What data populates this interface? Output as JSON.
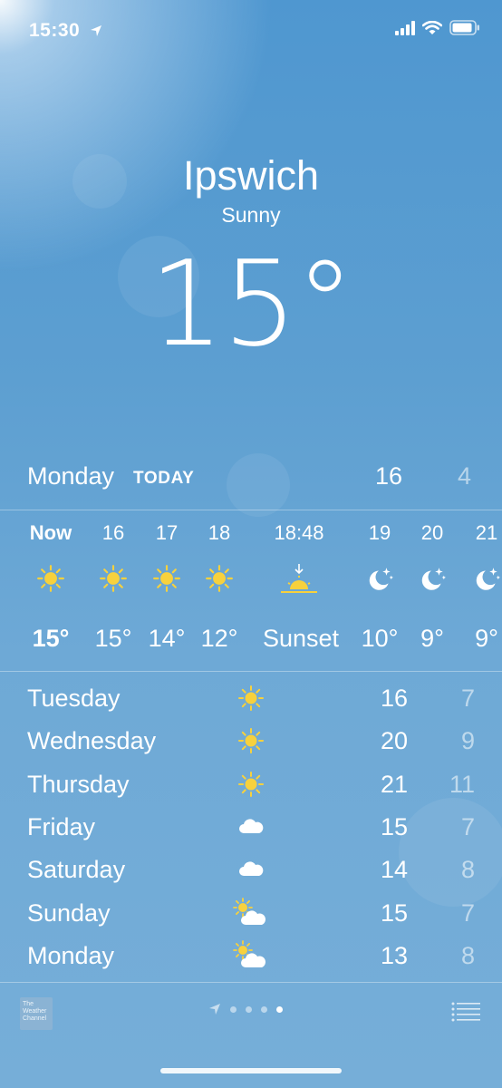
{
  "status_bar": {
    "time": "15:30"
  },
  "hero": {
    "city": "Ipswich",
    "condition": "Sunny",
    "temperature": "15°"
  },
  "today": {
    "day": "Monday",
    "tag": "TODAY",
    "high": "16",
    "low": "4"
  },
  "hourly": [
    {
      "time": "Now",
      "icon": "sun-icon",
      "temp": "15°",
      "bold": true
    },
    {
      "time": "16",
      "icon": "sun-icon",
      "temp": "15°"
    },
    {
      "time": "17",
      "icon": "sun-icon",
      "temp": "14°"
    },
    {
      "time": "18",
      "icon": "sun-icon",
      "temp": "12°"
    },
    {
      "time": "18:48",
      "icon": "sunset-icon",
      "temp": "Sunset"
    },
    {
      "time": "19",
      "icon": "moon-stars-icon",
      "temp": "10°"
    },
    {
      "time": "20",
      "icon": "moon-stars-icon",
      "temp": "9°"
    },
    {
      "time": "21",
      "icon": "moon-stars-icon",
      "temp": "9°"
    }
  ],
  "daily": [
    {
      "day": "Tuesday",
      "icon": "sun-icon",
      "high": "16",
      "low": "7"
    },
    {
      "day": "Wednesday",
      "icon": "sun-icon",
      "high": "20",
      "low": "9"
    },
    {
      "day": "Thursday",
      "icon": "sun-icon",
      "high": "21",
      "low": "11"
    },
    {
      "day": "Friday",
      "icon": "cloud-icon",
      "high": "15",
      "low": "7"
    },
    {
      "day": "Saturday",
      "icon": "cloud-icon",
      "high": "14",
      "low": "8"
    },
    {
      "day": "Sunday",
      "icon": "partly-cloudy-icon",
      "high": "15",
      "low": "7"
    },
    {
      "day": "Monday",
      "icon": "partly-cloudy-icon",
      "high": "13",
      "low": "8"
    }
  ],
  "footer": {
    "logo_text": "The Weather Channel",
    "pages": 4,
    "active_page": 4
  },
  "colors": {
    "sun": "#f7d13d",
    "background_top": "#4f97d0",
    "background_bottom": "#76aed8"
  }
}
